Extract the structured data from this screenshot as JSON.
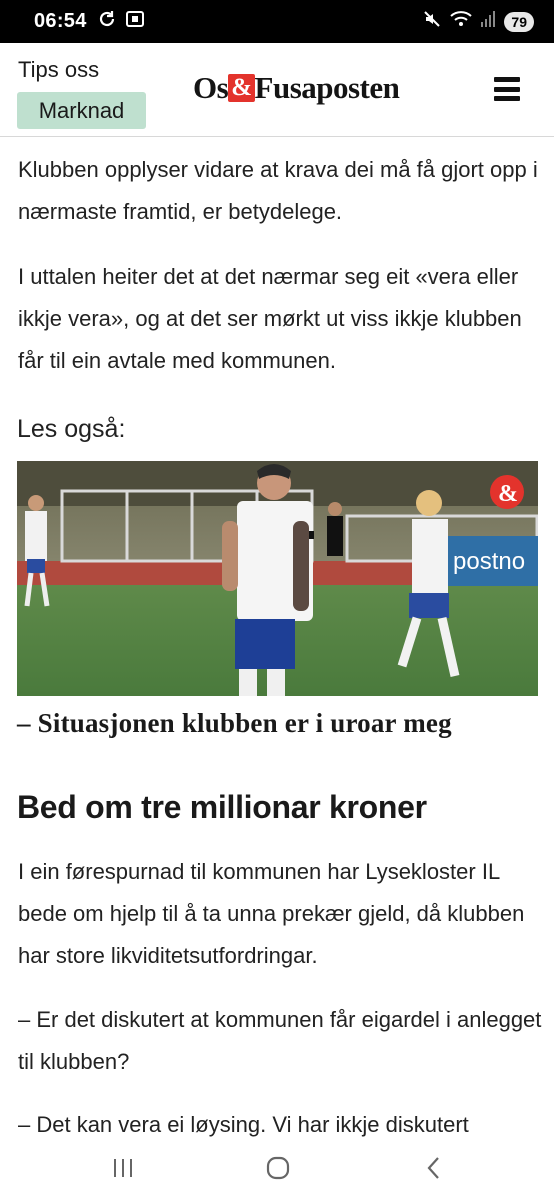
{
  "status_bar": {
    "time": "06:54",
    "battery": "79",
    "icons": [
      "sync-icon",
      "screenshot-icon",
      "mute-icon",
      "wifi-icon",
      "signal-icon"
    ]
  },
  "header": {
    "tips_label": "Tips oss",
    "tag_label": "Marknad",
    "logo_left": "Os",
    "logo_amp": "&",
    "logo_right": "Fusaposten",
    "tag_color": "#bfe0cf",
    "logo_accent": "#e3332c"
  },
  "article": {
    "paragraphs": [
      "Klubben opplyser vidare at krava dei må få gjort opp i nærmaste framtid, er betydelege.",
      "I uttalen heiter det at det nærmar seg eit «vera eller ikkje vera», og at det ser mørkt ut viss ikkje klubben får til ein avtale med kommunen."
    ],
    "read_also_label": "Les også:",
    "related": {
      "title": "– Situasjonen klubben er i uroar meg",
      "image_banner_text": "postno"
    },
    "section_heading": "Bed om tre millionar kroner",
    "paragraphs_after": [
      "I ein førespurnad til kommunen har Lysekloster IL bede om hjelp til å ta unna prekær gjeld, då klubben har store likviditetsutfordringar.",
      "– Er det diskutert at kommunen får eigardel i anlegget til klubben?",
      "– Det kan vera ei løysing. Vi har ikkje diskutert"
    ]
  },
  "nav_bar": {
    "buttons": [
      "recent-apps",
      "home",
      "back"
    ]
  }
}
